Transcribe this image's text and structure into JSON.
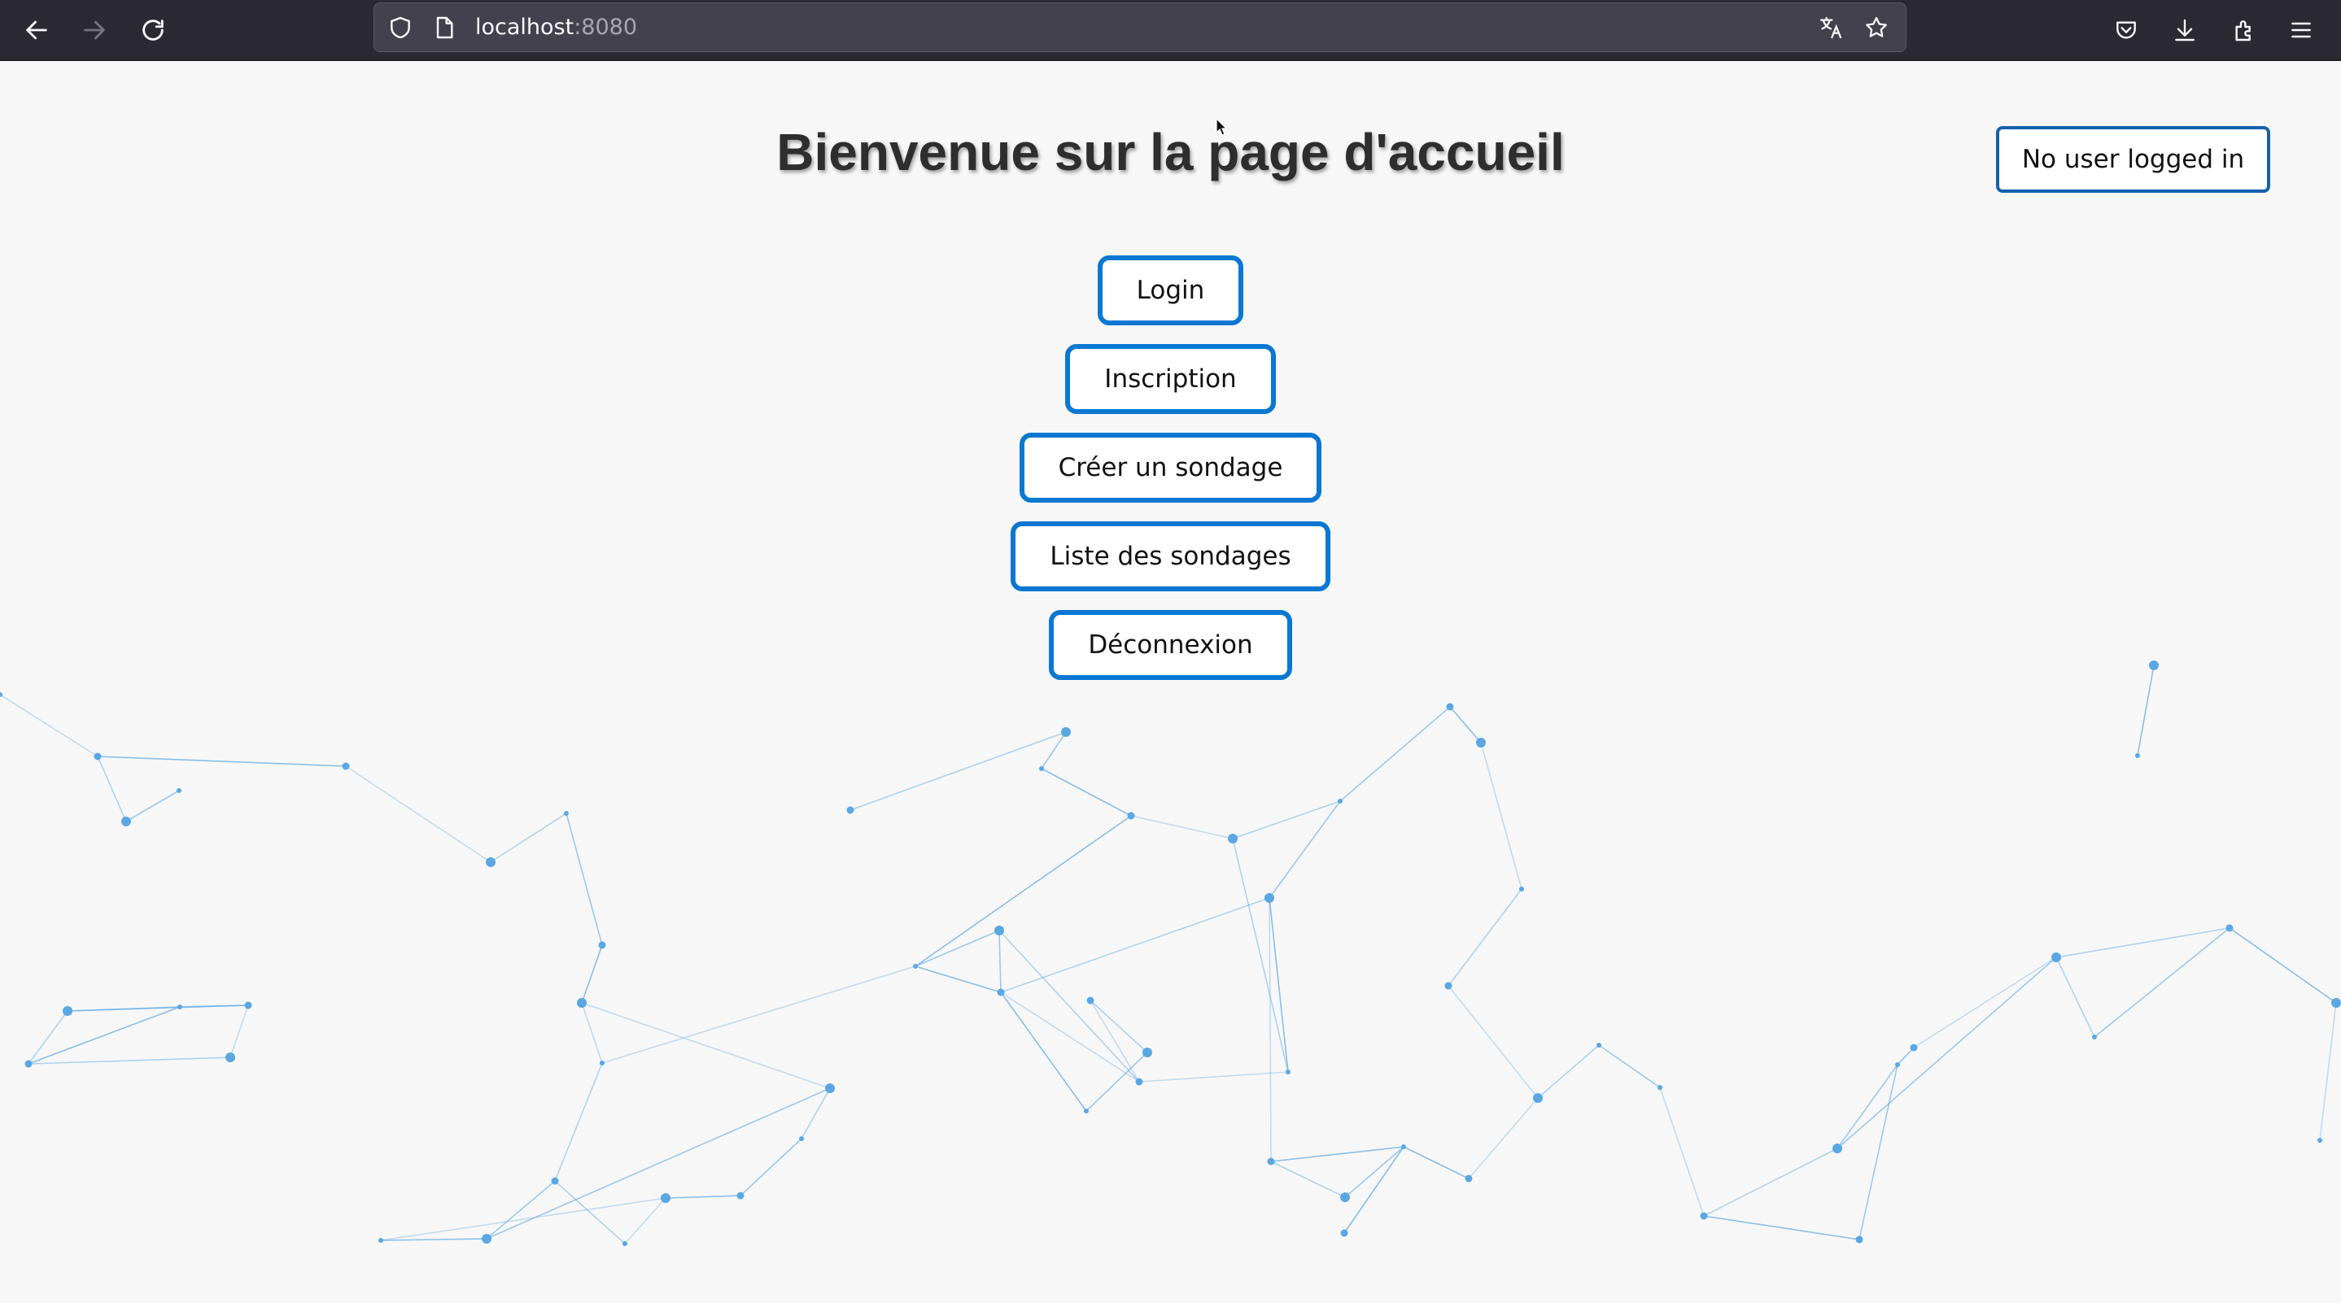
{
  "browser": {
    "url_host": "localhost",
    "url_port": ":8080",
    "icons": [
      "back-arrow-icon",
      "forward-arrow-icon",
      "reload-icon",
      "shield-icon",
      "page-icon",
      "translate-icon",
      "bookmark-star-icon",
      "pocket-icon",
      "download-icon",
      "extensions-icon",
      "menu-icon"
    ]
  },
  "page": {
    "title": "Bienvenue sur la page d'accueil",
    "user_status": "No user logged in",
    "menu": [
      {
        "label": "Login"
      },
      {
        "label": "Inscription"
      },
      {
        "label": "Créer un sondage"
      },
      {
        "label": "Liste des sondages"
      },
      {
        "label": "Déconnexion"
      }
    ]
  },
  "colors": {
    "button_border": "#0a78d2",
    "status_border": "#1561ad",
    "network": "#5aa7e3",
    "background": "#f7f7f7"
  }
}
